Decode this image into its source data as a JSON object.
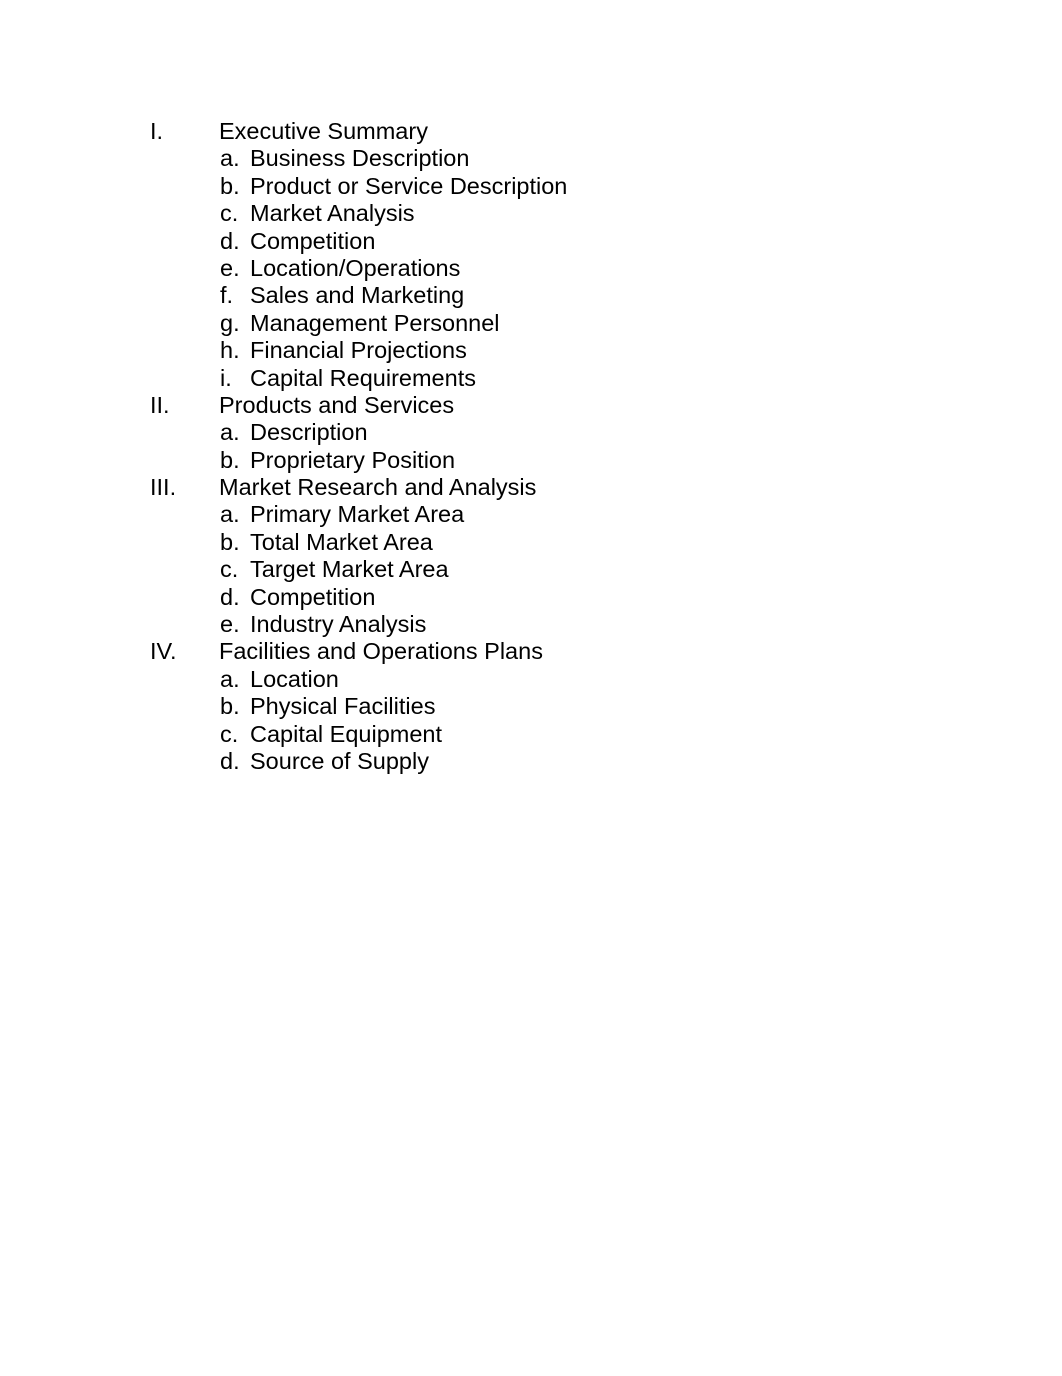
{
  "document": {
    "background_color": "#ffffff",
    "text_color": "#000000",
    "outline": [
      {
        "marker": "I.",
        "label": "Executive Summary",
        "children": [
          {
            "marker": "a.",
            "label": "Business Description"
          },
          {
            "marker": "b.",
            "label": "Product or Service Description"
          },
          {
            "marker": "c.",
            "label": "Market Analysis"
          },
          {
            "marker": "d.",
            "label": "Competition"
          },
          {
            "marker": "e.",
            "label": "Location/Operations"
          },
          {
            "marker": "f.",
            "label": "Sales and Marketing"
          },
          {
            "marker": "g.",
            "label": "Management Personnel"
          },
          {
            "marker": "h.",
            "label": "Financial Projections"
          },
          {
            "marker": "i.",
            "label": "Capital Requirements"
          }
        ]
      },
      {
        "marker": "II.",
        "label": "Products and Services",
        "children": [
          {
            "marker": "a.",
            "label": "Description"
          },
          {
            "marker": "b.",
            "label": "Proprietary Position"
          }
        ]
      },
      {
        "marker": "III.",
        "label": "Market Research and Analysis",
        "children": [
          {
            "marker": "a.",
            "label": "Primary Market Area"
          },
          {
            "marker": "b.",
            "label": "Total Market Area"
          },
          {
            "marker": "c.",
            "label": "Target Market Area"
          },
          {
            "marker": "d.",
            "label": "Competition"
          },
          {
            "marker": "e.",
            "label": "Industry Analysis"
          }
        ]
      },
      {
        "marker": "IV.",
        "label": "Facilities and Operations Plans",
        "children": [
          {
            "marker": "a.",
            "label": "Location"
          },
          {
            "marker": "b.",
            "label": "Physical Facilities"
          },
          {
            "marker": "c.",
            "label": "Capital Equipment"
          },
          {
            "marker": "d.",
            "label": "Source of Supply"
          }
        ]
      }
    ]
  }
}
